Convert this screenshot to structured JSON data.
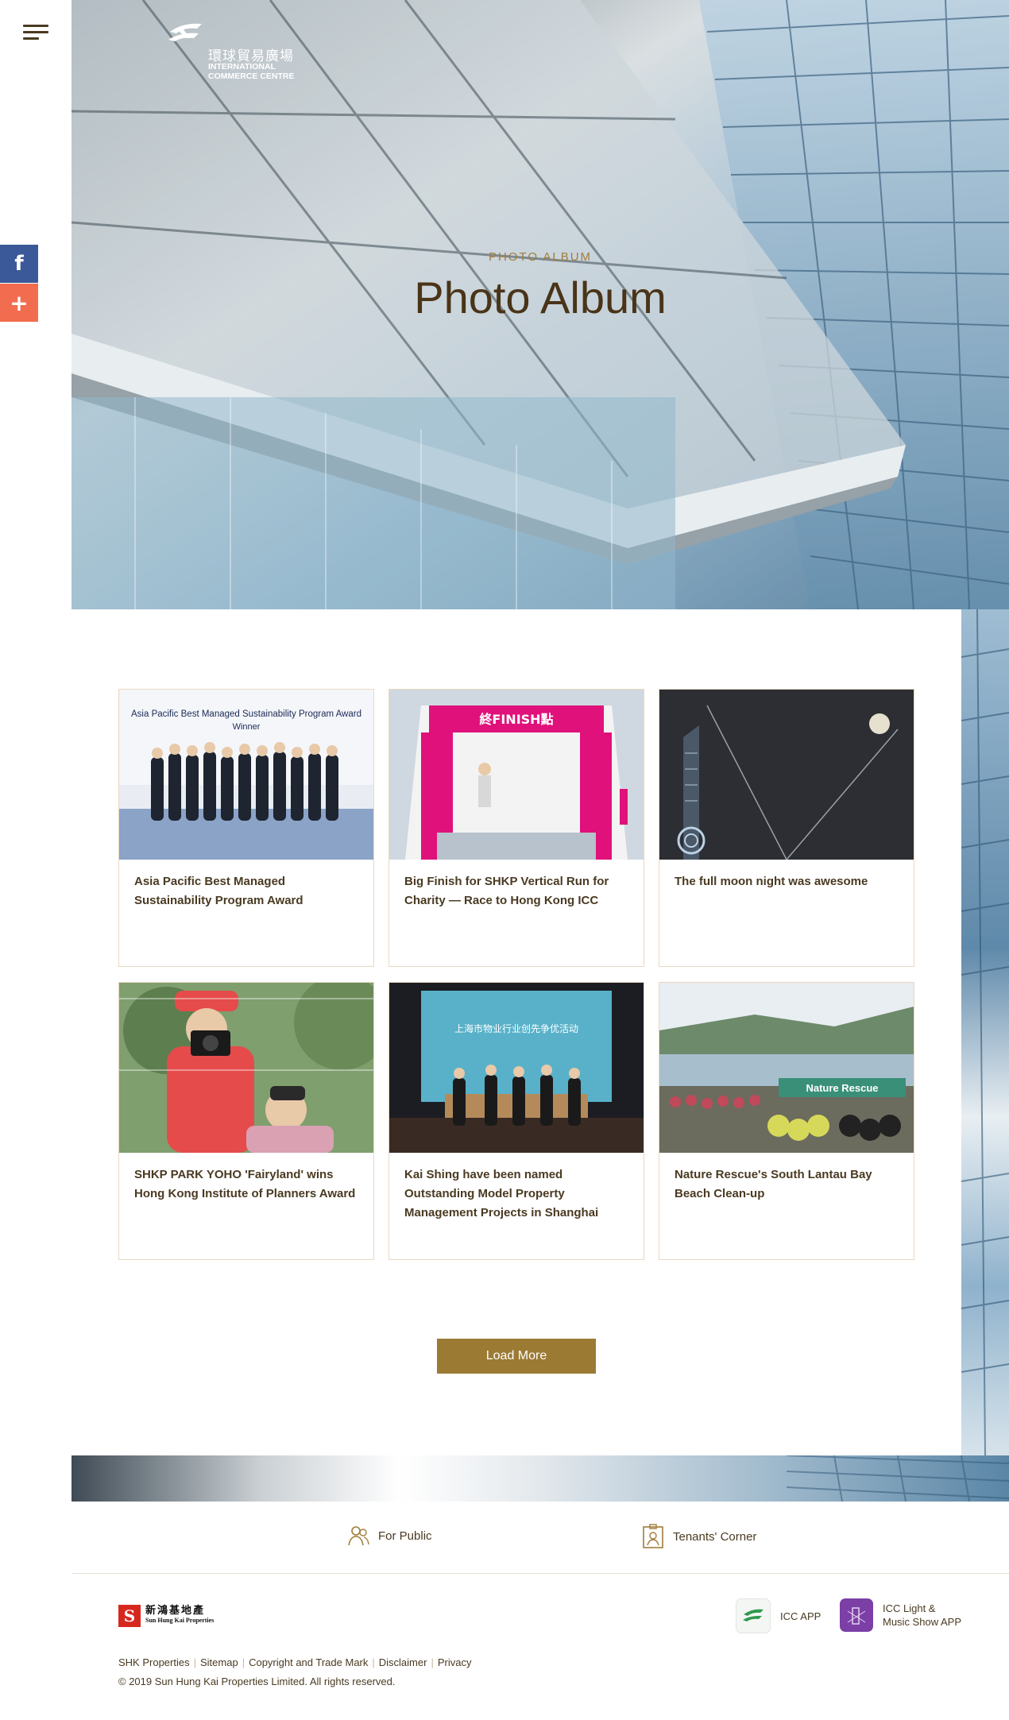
{
  "nav": {
    "menu_icon": "hamburger-menu-icon"
  },
  "share": {
    "facebook_glyph": "f",
    "more_glyph": "+"
  },
  "brand": {
    "name_cn": "環球貿易廣場",
    "name_en_line1": "INTERNATIONAL",
    "name_en_line2": "COMMERCE CENTRE"
  },
  "hero": {
    "eyebrow": "PHOTO ALBUM",
    "title": "Photo Album"
  },
  "albums": [
    {
      "caption": "Asia Pacific Best Managed Sustainability Program Award"
    },
    {
      "caption": "Big Finish for SHKP Vertical Run for Charity — Race to Hong Kong ICC"
    },
    {
      "caption": "The full moon night was awesome"
    },
    {
      "caption": "SHKP PARK YOHO 'Fairyland' wins Hong Kong Institute of Planners Award"
    },
    {
      "caption": "Kai Shing have been named Outstanding Model Property Management Projects in Shanghai"
    },
    {
      "caption": "Nature Rescue's South Lantau Bay Beach Clean-up"
    }
  ],
  "thumb_text": {
    "award_banner": "Asia Pacific Best Managed Sustainability Program Award",
    "award_winner": "Winner",
    "finish": "終FINISH點",
    "shanghai": "上海市物业行业创先争优活动",
    "nature": "Nature Rescue"
  },
  "load_more": "Load More",
  "footer": {
    "for_public": "For Public",
    "tenants_corner": "Tenants' Corner",
    "shk_cn": "新鴻基地產",
    "shk_en": "Sun Hung Kai Properties",
    "icc_app": "ICC APP",
    "light_app_line1": "ICC Light &",
    "light_app_line2": "Music Show APP",
    "links": [
      "SHK Properties",
      "Sitemap",
      "Copyright and Trade Mark",
      "Disclaimer",
      "Privacy"
    ],
    "copyright": "© 2019 Sun Hung Kai Properties Limited. All rights reserved."
  },
  "colors": {
    "accent_gold": "#9b7a34",
    "title_brown": "#4a3418",
    "facebook": "#3b5998",
    "share_orange": "#f26d4f"
  }
}
